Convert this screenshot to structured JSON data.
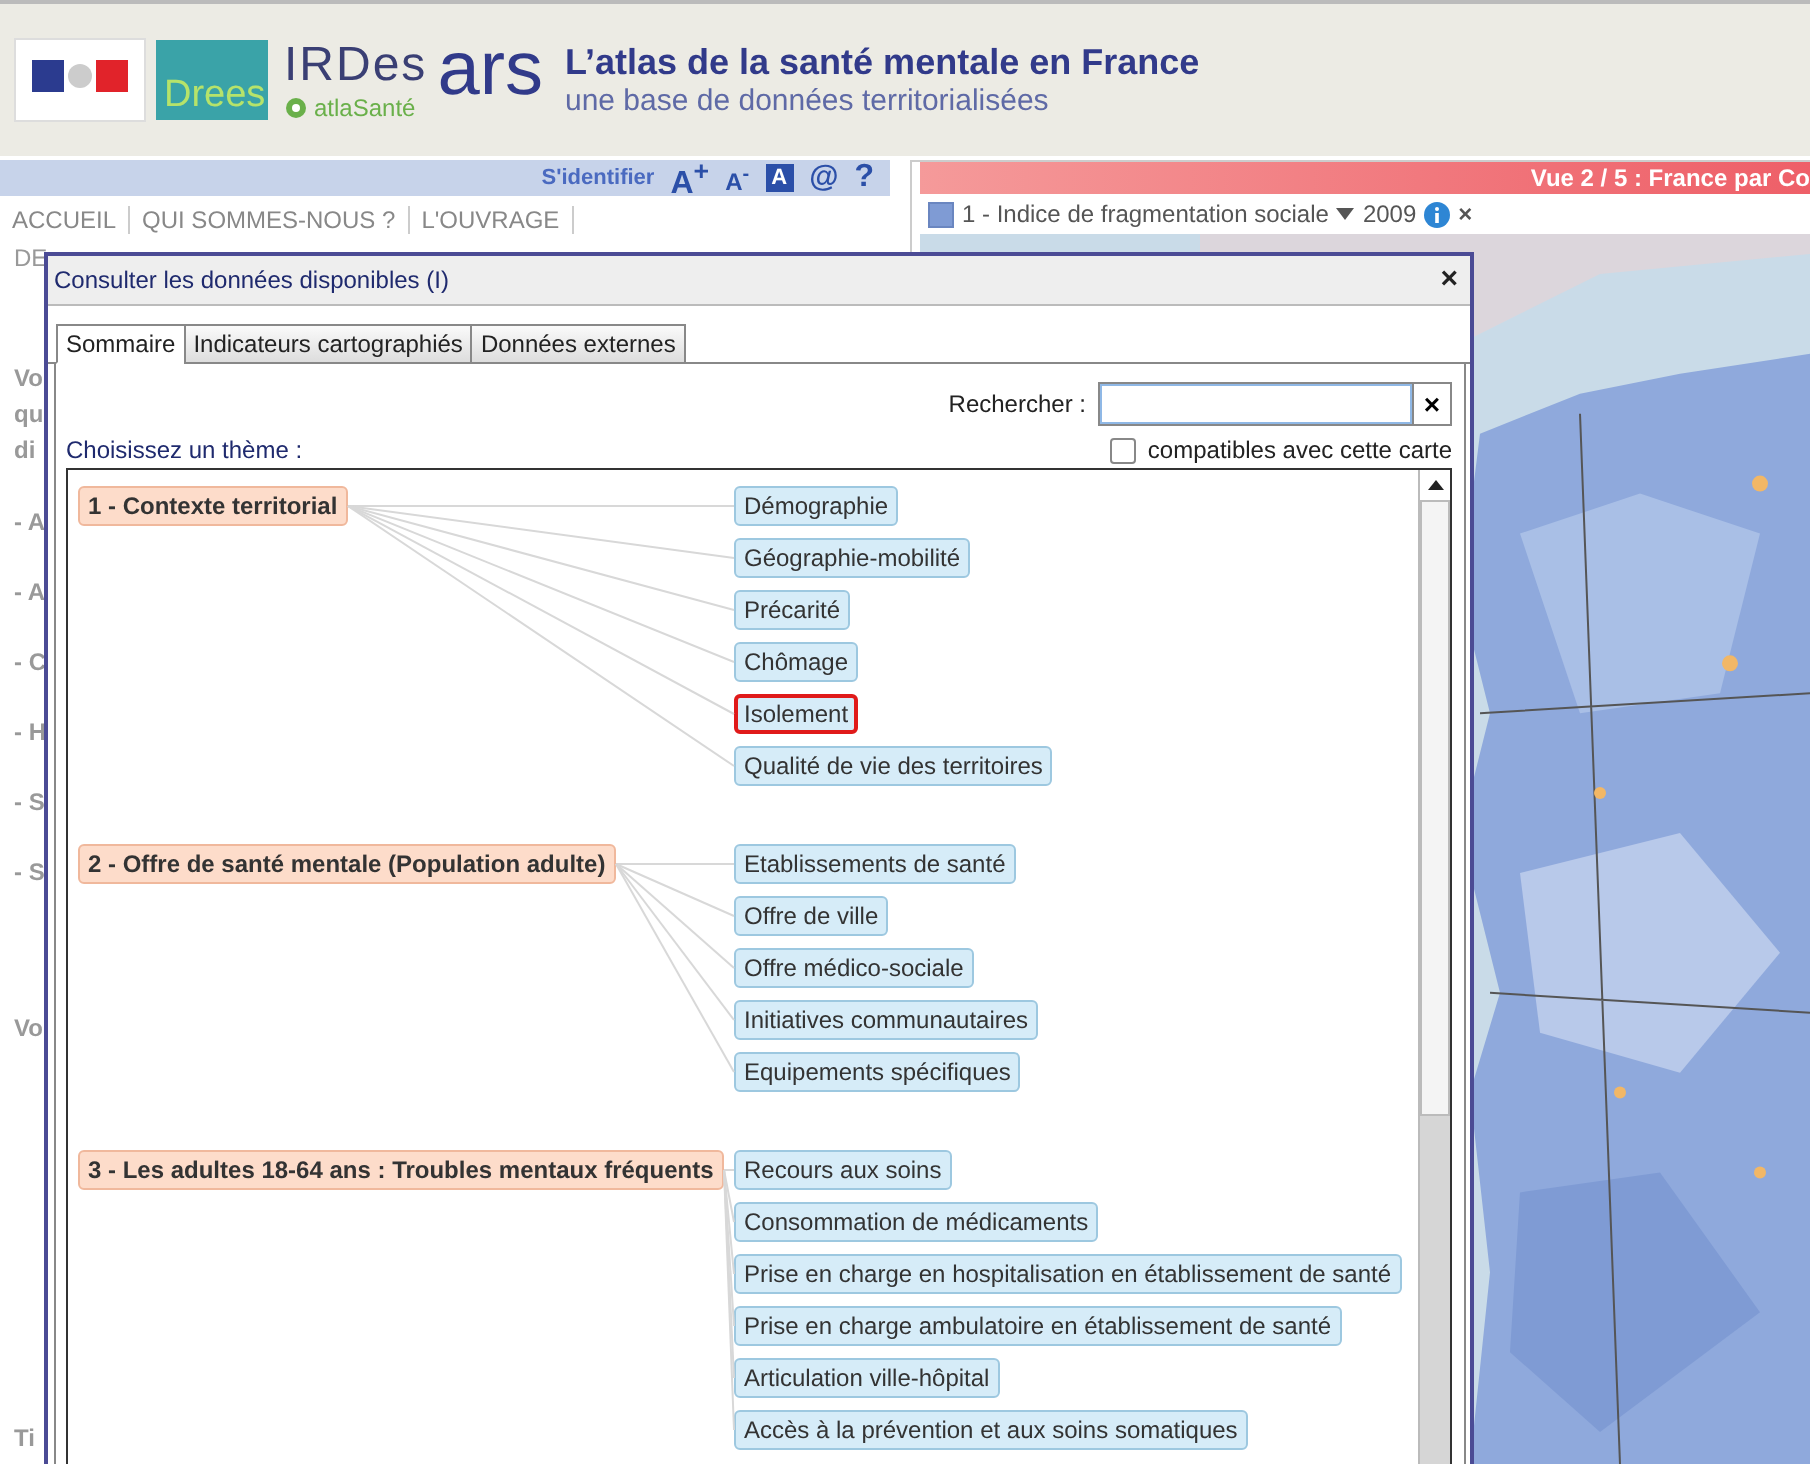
{
  "header": {
    "logos": {
      "drees": "Drees",
      "irdes": "IRDes",
      "atlasante": "atlaSanté",
      "ars": "ars"
    },
    "title": "L’atlas de la santé mentale en France",
    "subtitle": "une base de données territorialisées"
  },
  "toolbar": {
    "login": "S'identifier",
    "font_larger": "A$^{+}$",
    "font_smaller": "A$^{-}$",
    "contrast": "A",
    "contact": "@",
    "help": "?"
  },
  "nav": [
    "ACCUEIL",
    "QUI SOMMES-NOUS ?",
    "L'OUVRAGE"
  ],
  "page_fragments": {
    "nav_row2": "DE",
    "intro": [
      "Vo",
      "qu",
      "di"
    ],
    "links": [
      "- A",
      "- A",
      "- C",
      "- H",
      "- S",
      "- S"
    ],
    "section": "Vo",
    "footer": "Ti"
  },
  "map_panel": {
    "view_title": "Vue 2 / 5 : France par Co",
    "layer": {
      "name": "1 - Indice de fragmentation sociale",
      "year": "2009",
      "remove": "×"
    }
  },
  "dialog": {
    "title": "Consulter les données disponibles (I)",
    "close": "×",
    "tabs": [
      {
        "label": "Sommaire",
        "selected": true
      },
      {
        "label": "Indicateurs cartographiés",
        "selected": false
      },
      {
        "label": "Données externes",
        "selected": false
      }
    ],
    "search_label": "Rechercher :",
    "search_clear": "×",
    "theme_label": "Choisissez un thème :",
    "compatible_filter": {
      "label": "compatibles avec cette carte",
      "checked": false
    },
    "themes": [
      {
        "label": "1 - Contexte territorial",
        "children": [
          {
            "label": "Démographie",
            "selected": false
          },
          {
            "label": "Géographie-mobilité",
            "selected": false
          },
          {
            "label": "Précarité",
            "selected": false
          },
          {
            "label": "Chômage",
            "selected": false
          },
          {
            "label": "Isolement",
            "selected": true
          },
          {
            "label": "Qualité de vie des territoires",
            "selected": false
          }
        ]
      },
      {
        "label": "2 - Offre de santé mentale (Population adulte)",
        "children": [
          {
            "label": "Etablissements de santé",
            "selected": false
          },
          {
            "label": "Offre de ville",
            "selected": false
          },
          {
            "label": "Offre médico-sociale",
            "selected": false
          },
          {
            "label": "Initiatives communautaires",
            "selected": false
          },
          {
            "label": "Equipements spécifiques",
            "selected": false
          }
        ]
      },
      {
        "label": "3 - Les adultes 18-64 ans : Troubles mentaux fréquents",
        "children": [
          {
            "label": "Recours aux soins",
            "selected": false
          },
          {
            "label": "Consommation de médicaments",
            "selected": false
          },
          {
            "label": "Prise en charge en hospitalisation en établissement de santé",
            "selected": false
          },
          {
            "label": "Prise en charge ambulatoire en établissement de santé",
            "selected": false
          },
          {
            "label": "Articulation ville-hôpital",
            "selected": false
          },
          {
            "label": "Accès à la prévention et aux soins somatiques",
            "selected": false
          }
        ]
      }
    ]
  }
}
